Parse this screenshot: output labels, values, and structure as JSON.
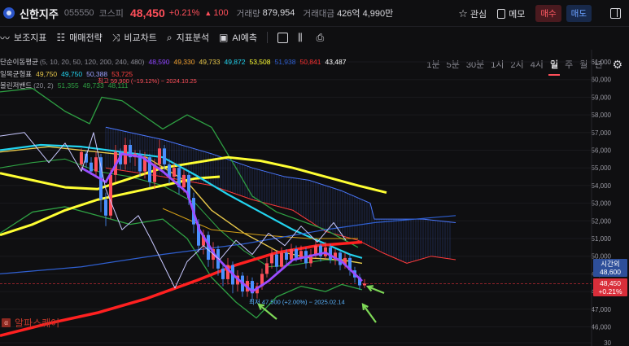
{
  "header": {
    "stock_name": "신한지주",
    "stock_code": "055550",
    "market": "코스피",
    "price": "48,450",
    "change_pct": "+0.21%",
    "change_arrow": "▲",
    "change_value": "100",
    "volume_label": "거래량",
    "volume": "879,954",
    "amount_label": "거래대금",
    "amount": "426억 4,990만",
    "watch_label": "관심",
    "memo_label": "메모",
    "buy_label": "매수",
    "sell_label": "매도"
  },
  "toolbar": {
    "items": [
      {
        "icon": "indicator-icon",
        "label": "보조지표"
      },
      {
        "icon": "strategy-icon",
        "label": "매매전략"
      },
      {
        "icon": "compare-icon",
        "label": "비교차트"
      },
      {
        "icon": "analysis-icon",
        "label": "지표분석"
      },
      {
        "icon": "ai-icon",
        "label": "AI예측"
      }
    ],
    "periods": [
      "1분",
      "5분",
      "30분",
      "1시",
      "2시",
      "4시",
      "일",
      "주",
      "월",
      "년"
    ],
    "active_period": "일"
  },
  "legend": {
    "ma_label": "단순이동평균",
    "ma_params": "(5, 10, 20, 50, 120, 200, 240, 480)",
    "ma_values": [
      {
        "v": "48,590",
        "c": "#8e44ff"
      },
      {
        "v": "49,330",
        "c": "#f0a030"
      },
      {
        "v": "49,733",
        "c": "#e8c84a"
      },
      {
        "v": "49,872",
        "c": "#22d3ee"
      },
      {
        "v": "53,508",
        "c": "#ffff33"
      },
      {
        "v": "51,938",
        "c": "#2f5fd0"
      },
      {
        "v": "50,841",
        "c": "#ff3030"
      },
      {
        "v": "43,487",
        "c": "#ffffff"
      }
    ],
    "ichi_label": "일목균형표",
    "ichi_values": [
      {
        "v": "49,750",
        "c": "#e8c84a"
      },
      {
        "v": "49,750",
        "c": "#22d3ee"
      },
      {
        "v": "50,388",
        "c": "#9aa0ff"
      },
      {
        "v": "53,725",
        "c": "#ff4040"
      }
    ],
    "bb_label": "볼린저밴드",
    "bb_params": "(20, 2)",
    "bb_values": [
      {
        "v": "51,355",
        "c": "#2ea043"
      },
      {
        "v": "49,733",
        "c": "#2ea043"
      },
      {
        "v": "48,111",
        "c": "#2ea043"
      }
    ],
    "hi_note": "최고 59,900 (−19.12%) − 2024.10.25"
  },
  "lo_note": "최저 47,500 (+2.00%) − 2025.02.14",
  "watermark": "알파스퀘어",
  "y_ticks": [
    "61,000",
    "60,000",
    "59,000",
    "58,000",
    "57,000",
    "56,000",
    "55,000",
    "54,000",
    "53,000",
    "52,000",
    "51,000",
    "50,000",
    "49,000",
    "48,000",
    "47,000",
    "46,000",
    "30"
  ],
  "time_tag": {
    "label": "시간외",
    "value": "48,600"
  },
  "price_tag": {
    "value": "48,450",
    "pct": "+0.21%"
  },
  "colors": {
    "up": "#ff4f5a",
    "down": "#4a90ff",
    "bg": "#0f0f11"
  }
}
